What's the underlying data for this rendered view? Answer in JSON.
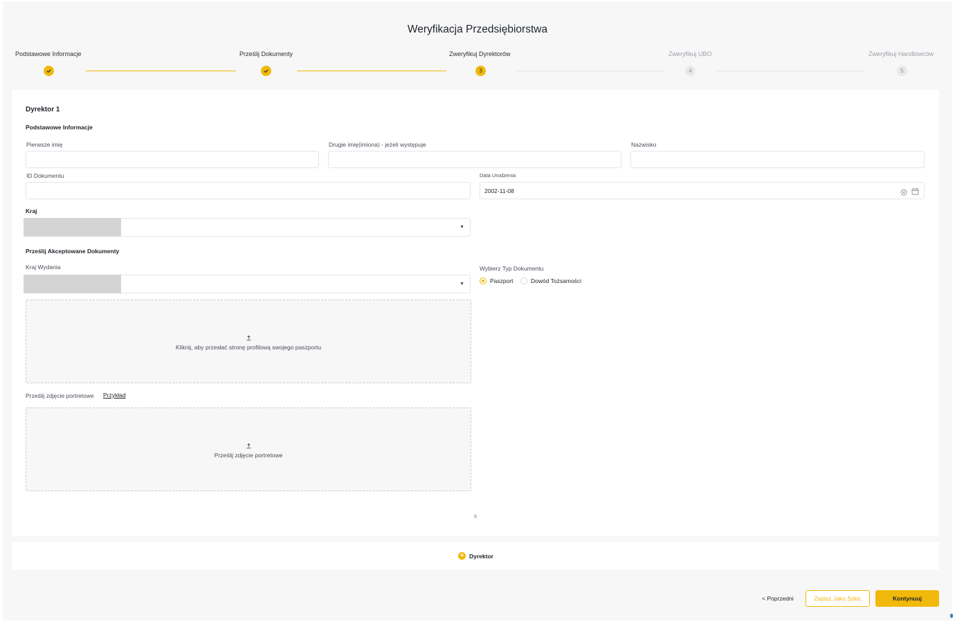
{
  "page": {
    "title": "Weryfikacja Przedsiębiorstwa"
  },
  "stepper": {
    "steps": [
      {
        "label": "Podstawowe Informacje",
        "status": "done",
        "number": ""
      },
      {
        "label": "Prześlij Dokumenty",
        "status": "done",
        "number": ""
      },
      {
        "label": "Zweryfikuj Dyrektorów",
        "status": "active",
        "number": "3"
      },
      {
        "label": "Zweryfikuj UBO",
        "status": "pending",
        "number": "4"
      },
      {
        "label": "Zweryfikuj Handlowców",
        "status": "pending",
        "number": "5"
      }
    ]
  },
  "director": {
    "heading": "Dyrektor 1",
    "basic_info_heading": "Podstawowe Informacje",
    "first_name": {
      "label": "Pierwsze imię",
      "value": ""
    },
    "middle_name": {
      "label": "Drugie imię(imiona) - jeżeli występuje",
      "value": ""
    },
    "last_name": {
      "label": "Nazwisko",
      "value": ""
    },
    "document_id": {
      "label": "ID Dokumentu",
      "value": ""
    },
    "birth_date": {
      "label": "Data Urodzenia",
      "value": "2002-11-08"
    },
    "country": {
      "label": "Kraj",
      "value": ""
    },
    "documents_heading": "Prześlij Akceptowane Dokumenty",
    "issue_country": {
      "label": "Kraj Wydania",
      "value": ""
    },
    "document_type": {
      "label": "Wybierz Typ Dokumentu",
      "options": [
        "Paszport",
        "Dowód Tożsamości"
      ],
      "selected": "Paszport"
    },
    "passport_upload": {
      "text": "Kliknij, aby przesłać stronę profilową swojego paszportu",
      "icon": "upload-icon"
    },
    "portrait_label": "Prześlij zdjęcie portretowe",
    "portrait_example": "Przykład",
    "portrait_upload": {
      "text": "Prześlij zdjęcie portretowe",
      "icon": "upload-icon"
    }
  },
  "add_director": {
    "label": "Dyrektor",
    "icon": "plus-circle-icon"
  },
  "footer": {
    "prev_label": "< Poprzedni",
    "draft_label": "Zapisz Jako Szkic",
    "next_label": "Kontynuuj"
  },
  "colors": {
    "accent": "#f0b90b",
    "background": "#f7f7f7",
    "text": "#1e2329"
  }
}
